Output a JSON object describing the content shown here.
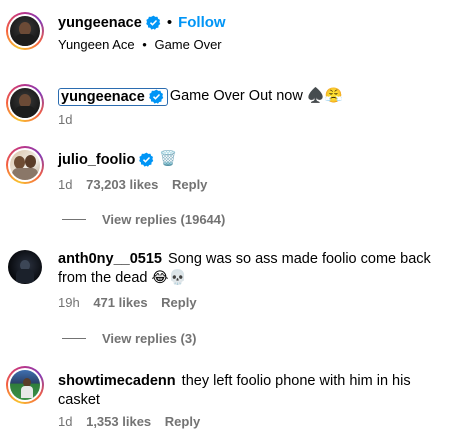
{
  "header": {
    "username": "yungeenace",
    "follow_label": "Follow",
    "separator": "•",
    "subtitle_artist": "Yungeen Ace",
    "subtitle_separator": "•",
    "subtitle_song": "Game Over"
  },
  "caption": {
    "username": "yungeenace",
    "text": "Game Over Out now ♠️😤",
    "time": "1d"
  },
  "comments": [
    {
      "username": "julio_foolio",
      "text": "🗑️",
      "time": "1d",
      "likes": "73,203 likes",
      "reply_label": "Reply",
      "view_replies": "View replies (19644)"
    },
    {
      "username": "anth0ny__0515",
      "text": "Song was so ass made foolio come back from the dead 😂💀",
      "time": "19h",
      "likes": "471 likes",
      "reply_label": "Reply",
      "view_replies": "View replies (3)"
    },
    {
      "username": "showtimecadenn",
      "text": "they left foolio phone with him in his casket",
      "time": "1d",
      "likes": "1,353 likes",
      "reply_label": "Reply"
    }
  ],
  "colors": {
    "link_blue": "#0095f6",
    "verified_blue": "#0095f6",
    "meta_gray": "#737373"
  },
  "icons": {
    "verified": "verified-badge-icon"
  }
}
